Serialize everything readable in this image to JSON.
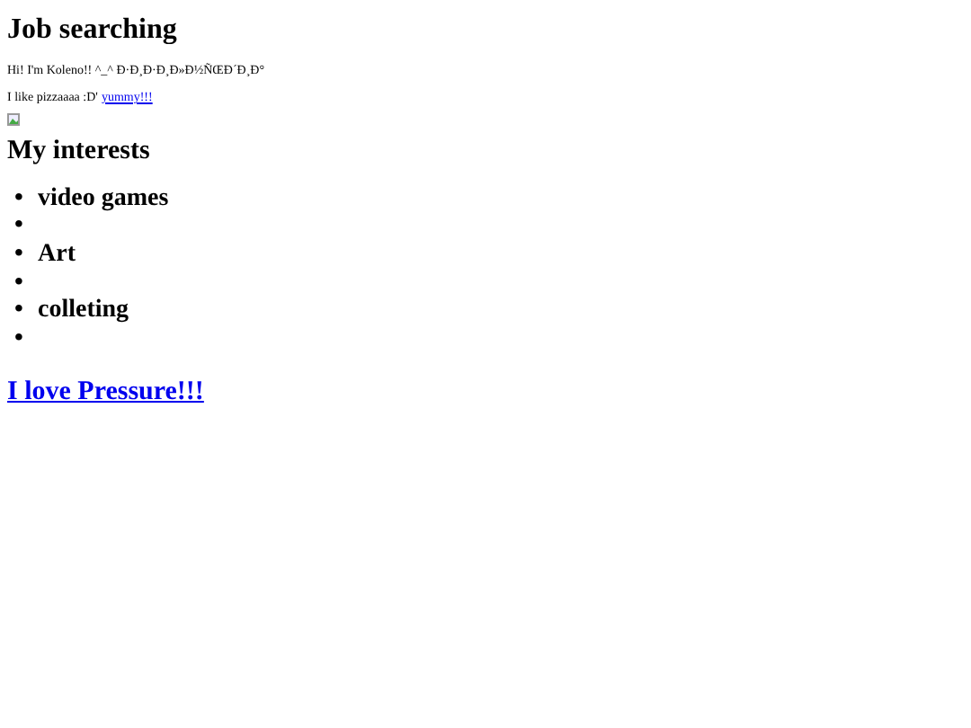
{
  "title": "Job searching",
  "intro": "Hi! I'm Koleno!! ^_^ Đ·Đ¸Đ·Đ¸Đ»Đ½ÑŒĐ´Đ¸Đ°",
  "pizza": {
    "text": "I like pizzaaaa :D'",
    "link": "yummy!!!"
  },
  "image": {
    "kind": "broken-image"
  },
  "interests": {
    "heading": "My interests",
    "items": [
      {
        "bullet": "•",
        "label": "video games"
      },
      {
        "bullet": "•"
      },
      {
        "bullet": "•",
        "label": "Art"
      },
      {
        "bullet": "•"
      },
      {
        "bullet": "•",
        "label": "colleting"
      },
      {
        "bullet": "•"
      }
    ]
  },
  "link": "I love Pressure!!!"
}
